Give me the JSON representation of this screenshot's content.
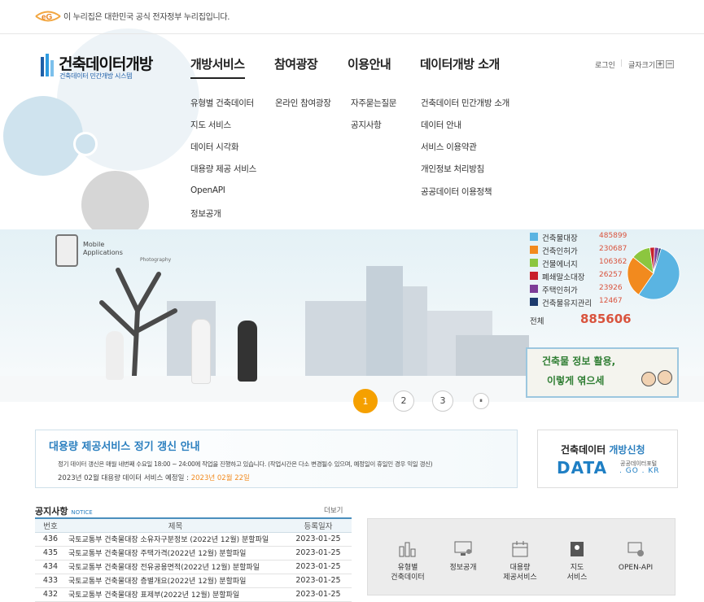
{
  "gov_banner": {
    "logo": "eG",
    "text": "이 누리집은 대한민국 공식 전자정부 누리집입니다."
  },
  "brand": {
    "title": "건축데이터개방",
    "subtitle": "건축데이터 민간개방 시스템"
  },
  "nav": {
    "menus": [
      {
        "label": "개방서비스",
        "items": [
          "유형별 건축데이터",
          "지도 서비스",
          "데이터 시각화",
          "대용량 제공 서비스",
          "OpenAPI",
          "정보공개"
        ]
      },
      {
        "label": "참여광장",
        "items": [
          "온라인 참여광장"
        ]
      },
      {
        "label": "이용안내",
        "items": [
          "자주묻는질문",
          "공지사항"
        ]
      },
      {
        "label": "데이터개방 소개",
        "items": [
          "건축데이터 민간개방 소개",
          "데이터 안내",
          "서비스 이용약관",
          "개인정보 처리방침",
          "공공데이터 이용정책"
        ]
      }
    ],
    "login": "로그인",
    "font_size_label": "글자크기",
    "zoom_in": "+",
    "zoom_out": "−"
  },
  "hero": {
    "mobile_label": "Mobile\nApplications",
    "photography_label": "Photography",
    "stats": [
      {
        "label": "건축물대장",
        "value": 485899,
        "color": "#5ab4e2"
      },
      {
        "label": "건축인허가",
        "value": 230687,
        "color": "#f28a1e"
      },
      {
        "label": "건물에너지",
        "value": 106362,
        "color": "#8cc63f"
      },
      {
        "label": "폐쇄말소대장",
        "value": 26257,
        "color": "#c8202a"
      },
      {
        "label": "주택인허가",
        "value": 23926,
        "color": "#7d3c98"
      },
      {
        "label": "건축물유지관리",
        "value": 12467,
        "color": "#1d3b6e"
      }
    ],
    "total_label": "전체",
    "total_value": "885606",
    "promo_text_1": "건축물 정보 활용,",
    "promo_text_2": "이렇게 엮으세",
    "pager": [
      "1",
      "2",
      "3"
    ],
    "pause": "⏸"
  },
  "notice_banner": {
    "title": "대용량 제공서비스 정기 갱신 안내",
    "line1": "정기 데이터 갱신은 매월 네번째 수요일 18:00 ~ 24:00에 작업을 진행하고 있습니다. (작업시간은 다소 변경될수 있으며, 예정일이 휴일인 경우 익일 갱신)",
    "line2_prefix": "2023년 02월 대용량 데이터 서비스 예정일 : ",
    "line2_date": "2023년 02월 22일"
  },
  "apply": {
    "title_a": "건축데이터",
    "title_b": "개방신청",
    "brand": "DATA",
    "sub1": "공공데이터포털",
    "sub2": ". GO . KR"
  },
  "notices": {
    "heading": "공지사항",
    "heading_en": "NOTICE",
    "more": "더보기",
    "columns": [
      "번호",
      "제목",
      "등록일자"
    ],
    "rows": [
      {
        "no": "436",
        "title": "국토교통부 건축물대장 소유자구분정보 (2022년 12월) 분할파일",
        "date": "2023-01-25"
      },
      {
        "no": "435",
        "title": "국토교통부 건축물대장 주택가격(2022년 12월) 분할파일",
        "date": "2023-01-25"
      },
      {
        "no": "434",
        "title": "국토교통부 건축물대장 전유공용면적(2022년 12월) 분할파일",
        "date": "2023-01-25"
      },
      {
        "no": "433",
        "title": "국토교통부 건축물대장 층별개요(2022년 12월) 분할파일",
        "date": "2023-01-25"
      },
      {
        "no": "432",
        "title": "국토교통부 건축물대장 표제부(2022년 12월) 분할파일",
        "date": "2023-01-25"
      }
    ]
  },
  "quick": [
    {
      "label": "유형별\n건축데이터",
      "icon": "building-chart-icon"
    },
    {
      "label": "정보공개",
      "icon": "monitor-icon"
    },
    {
      "label": "대용량\n제공서비스",
      "icon": "calendar-icon"
    },
    {
      "label": "지도\n서비스",
      "icon": "map-icon"
    },
    {
      "label": "OPEN-API",
      "icon": "api-icon"
    }
  ]
}
